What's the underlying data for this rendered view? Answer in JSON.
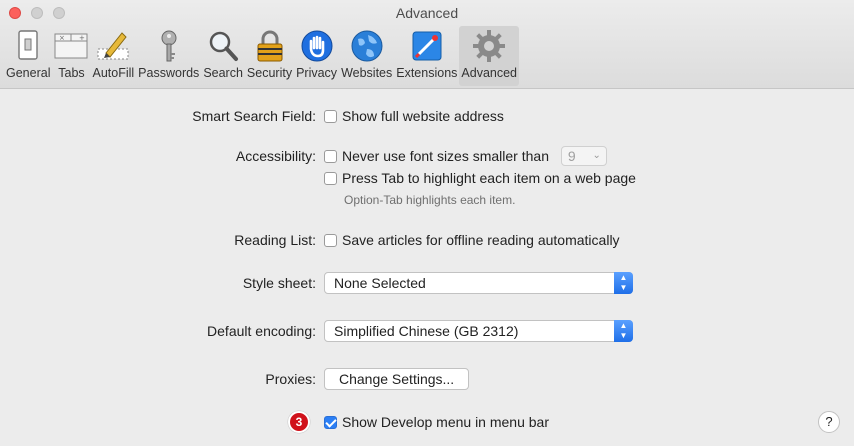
{
  "window": {
    "title": "Advanced"
  },
  "toolbar": {
    "items": [
      {
        "label": "General",
        "icon": "general-icon"
      },
      {
        "label": "Tabs",
        "icon": "tabs-icon"
      },
      {
        "label": "AutoFill",
        "icon": "autofill-icon"
      },
      {
        "label": "Passwords",
        "icon": "key-icon"
      },
      {
        "label": "Search",
        "icon": "search-icon"
      },
      {
        "label": "Security",
        "icon": "padlock-icon"
      },
      {
        "label": "Privacy",
        "icon": "hand-icon"
      },
      {
        "label": "Websites",
        "icon": "globe-icon"
      },
      {
        "label": "Extensions",
        "icon": "puzzle-icon"
      },
      {
        "label": "Advanced",
        "icon": "gear-icon",
        "active": true
      }
    ]
  },
  "settings": {
    "smart_search": {
      "label": "Smart Search Field:",
      "option": "Show full website address",
      "checked": false
    },
    "accessibility": {
      "label": "Accessibility:",
      "font_option": "Never use font sizes smaller than",
      "font_size": "9",
      "tab_option": "Press Tab to highlight each item on a web page",
      "hint": "Option-Tab highlights each item."
    },
    "reading_list": {
      "label": "Reading List:",
      "option": "Save articles for offline reading automatically"
    },
    "style_sheet": {
      "label": "Style sheet:",
      "value": "None Selected"
    },
    "encoding": {
      "label": "Default encoding:",
      "value": "Simplified Chinese (GB 2312)"
    },
    "proxies": {
      "label": "Proxies:",
      "button": "Change Settings..."
    },
    "develop": {
      "option": "Show Develop menu in menu bar",
      "checked": true,
      "badge": "3"
    }
  },
  "help": {
    "label": "?"
  },
  "colors": {
    "accent": "#2b7ff5",
    "badge": "#d0121b"
  }
}
